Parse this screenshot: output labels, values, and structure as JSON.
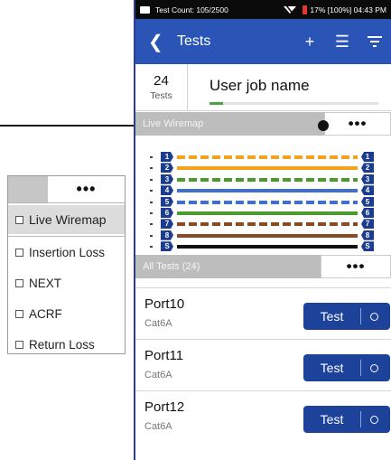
{
  "status_bar": {
    "test_count": "Test Count: 105/2500",
    "battery_info": "17% [100%] 04:43 PM"
  },
  "app_bar": {
    "title": "Tests",
    "back_icon": "chevron-left-icon",
    "add_icon": "plus-icon",
    "list_icon": "list-icon",
    "filter_icon": "filter-icon"
  },
  "job": {
    "count": "24",
    "count_label": "Tests",
    "name": "User job name",
    "progress": 0.08
  },
  "live_wiremap": {
    "label": "Live Wiremap",
    "more_label": "•••",
    "pins": [
      {
        "number": "1",
        "color": "#f5a11c",
        "dashed": true
      },
      {
        "number": "2",
        "color": "#f5a11c",
        "dashed": false
      },
      {
        "number": "3",
        "color": "#4a9a2e",
        "dashed": true
      },
      {
        "number": "4",
        "color": "#3f6fd1",
        "dashed": false
      },
      {
        "number": "5",
        "color": "#3f6fd1",
        "dashed": true
      },
      {
        "number": "6",
        "color": "#4a9a2e",
        "dashed": false
      },
      {
        "number": "7",
        "color": "#8a4a22",
        "dashed": true
      },
      {
        "number": "8",
        "color": "#8a4a22",
        "dashed": false
      },
      {
        "number": "S",
        "color": "#111111",
        "dashed": false
      }
    ]
  },
  "menu": {
    "more_label": "•••",
    "items": [
      "Live Wiremap",
      "Insertion Loss",
      "NEXT",
      "ACRF",
      "Return Loss"
    ]
  },
  "all_tests": {
    "label": "All Tests (24)",
    "more_label": "•••",
    "ports": [
      {
        "name": "Port10",
        "cable": "Cat6A",
        "button": "Test"
      },
      {
        "name": "Port11",
        "cable": "Cat6A",
        "button": "Test"
      },
      {
        "name": "Port12",
        "cable": "Cat6A",
        "button": "Test"
      }
    ]
  }
}
